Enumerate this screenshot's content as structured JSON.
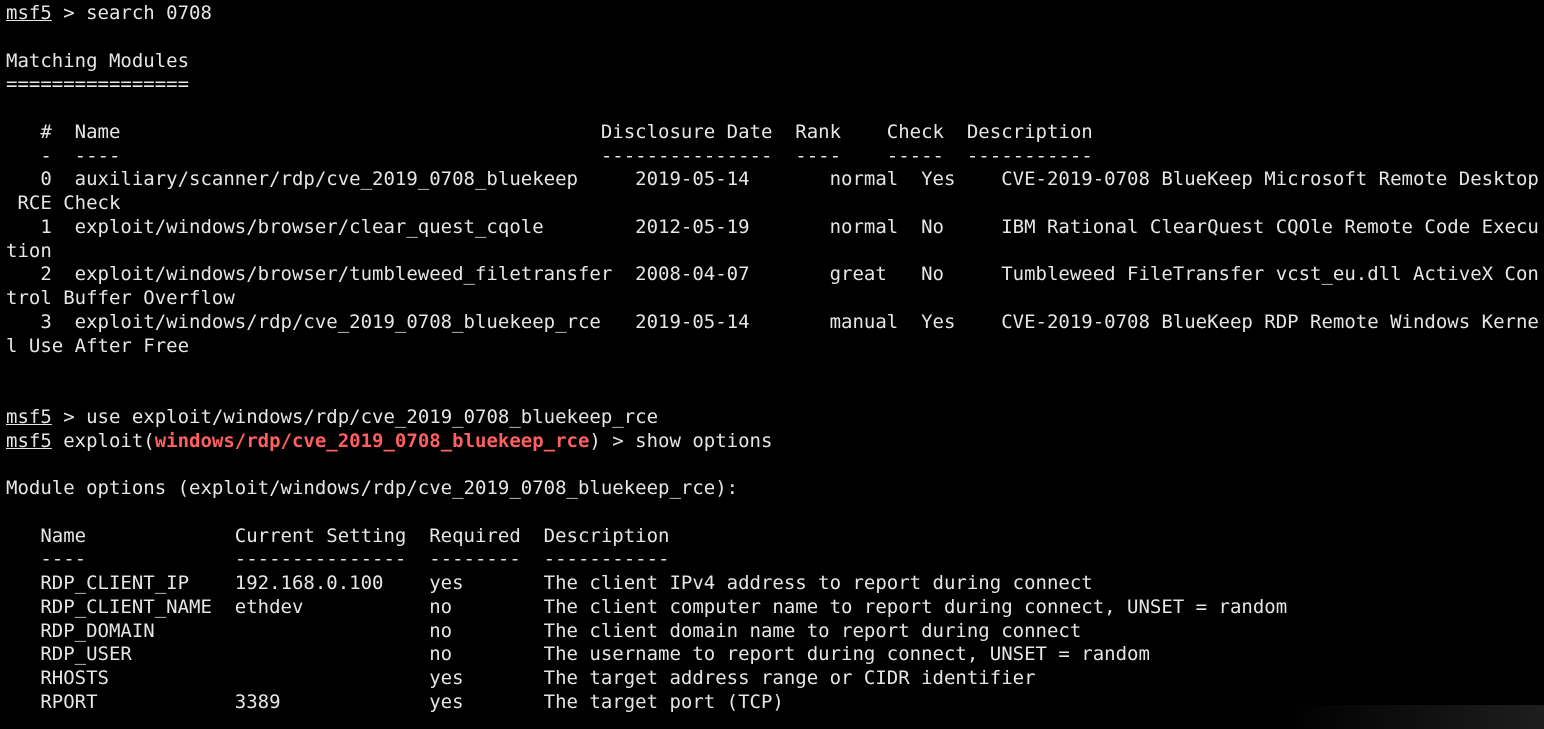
{
  "colors": {
    "background": "#000000",
    "foreground": "#e6e6e6",
    "module_highlight": "#ff5f5f"
  },
  "session": {
    "prompt": "msf5",
    "search_cmd": " > search 0708",
    "use_cmd": " > use exploit/windows/rdp/cve_2019_0708_bluekeep_rce",
    "exploit_prefix": " exploit(",
    "exploit_module": "windows/rdp/cve_2019_0708_bluekeep_rce",
    "exploit_suffix": ") > show options"
  },
  "search_results": {
    "heading": "Matching Modules",
    "heading_rule": "================",
    "header": "   #  Name                                          Disclosure Date  Rank    Check  Description",
    "separator": "   -  ----                                          ---------------  ----    -----  -----------",
    "lines": [
      "   0  auxiliary/scanner/rdp/cve_2019_0708_bluekeep     2019-05-14       normal  Yes    CVE-2019-0708 BlueKeep Microsoft Remote Desktop",
      " RCE Check",
      "   1  exploit/windows/browser/clear_quest_cqole        2012-05-19       normal  No     IBM Rational ClearQuest CQOle Remote Code Execu",
      "tion",
      "   2  exploit/windows/browser/tumbleweed_filetransfer  2008-04-07       great   No     Tumbleweed FileTransfer vcst_eu.dll ActiveX Con",
      "trol Buffer Overflow",
      "   3  exploit/windows/rdp/cve_2019_0708_bluekeep_rce   2019-05-14       manual  Yes    CVE-2019-0708 BlueKeep RDP Remote Windows Kerne",
      "l Use After Free"
    ]
  },
  "module_options": {
    "title": "Module options (exploit/windows/rdp/cve_2019_0708_bluekeep_rce):",
    "header": "   Name             Current Setting  Required  Description",
    "separator": "   ----             ---------------  --------  -----------",
    "lines": [
      "   RDP_CLIENT_IP    192.168.0.100    yes       The client IPv4 address to report during connect",
      "   RDP_CLIENT_NAME  ethdev           no        The client computer name to report during connect, UNSET = random",
      "   RDP_DOMAIN                        no        The client domain name to report during connect",
      "   RDP_USER                          no        The username to report during connect, UNSET = random",
      "   RHOSTS                            yes       The target address range or CIDR identifier",
      "   RPORT            3389             yes       The target port (TCP)"
    ]
  }
}
